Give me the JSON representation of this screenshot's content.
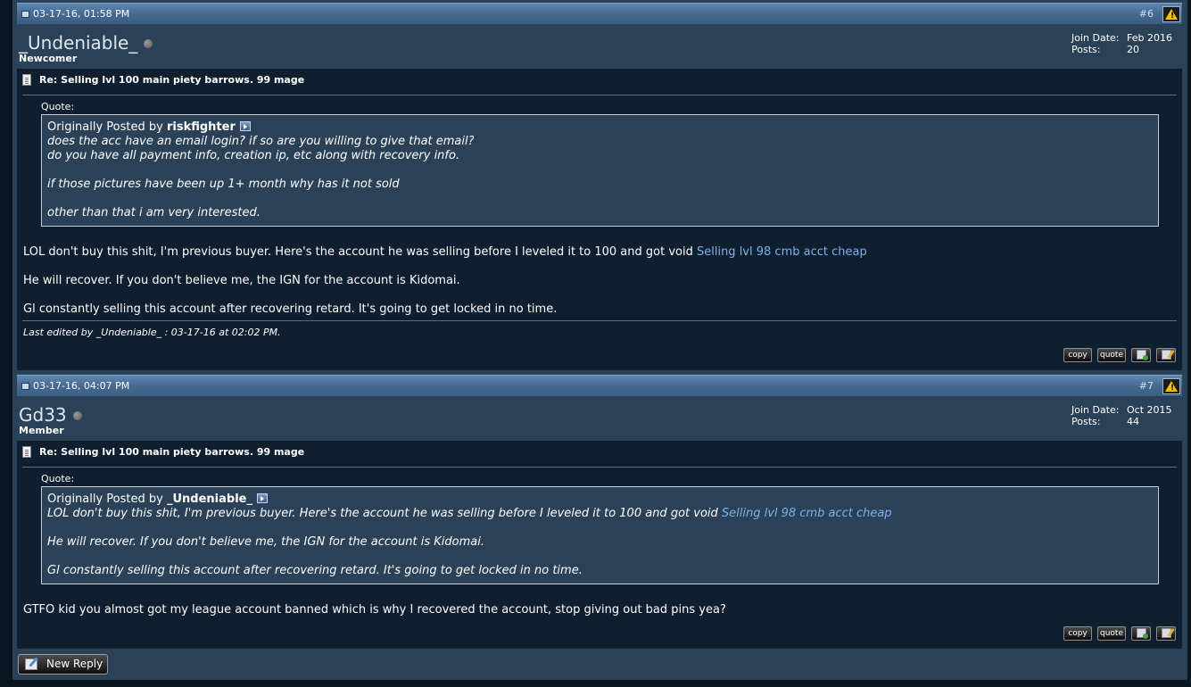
{
  "posts": [
    {
      "date": "03-17-16, 01:58 PM",
      "number": "#6",
      "username": "_Undeniable_",
      "usertitle": "Newcomer",
      "join_date_label": "Join Date:",
      "join_date": "Feb 2016",
      "posts_label": "Posts:",
      "posts_count": "20",
      "title": "Re: Selling lvl 100 main piety barrows. 99 mage",
      "quote_label": "Quote:",
      "quote_prefix": "Originally Posted by",
      "quote_author": "riskfighter",
      "quote_lines": [
        "does the acc have an email login? if so are you willing to give that email?",
        "do you have all payment info, creation ip, etc along with recovery info.",
        "",
        "if those pictures have been up 1+ month why has it not sold",
        "",
        "other than that i am very interested."
      ],
      "message_1": "LOL don't buy this shit, I'm previous buyer. Here's the account he was selling before I leveled it to 100 and got void ",
      "message_1_link": "Selling lvl 98 cmb acct cheap",
      "message_2": "He will recover. If you don't believe me, the IGN for the account is Kidomai.",
      "message_3": "Gl constantly selling this account after recovering retard. It's going to get locked in no time.",
      "edited": "Last edited by _Undeniable_ : 03-17-16 at 02:02 PM."
    },
    {
      "date": "03-17-16, 04:07 PM",
      "number": "#7",
      "username": "Gd33",
      "usertitle": "Member",
      "join_date_label": "Join Date:",
      "join_date": "Oct 2015",
      "posts_label": "Posts:",
      "posts_count": "44",
      "title": "Re: Selling lvl 100 main piety barrows. 99 mage",
      "quote_label": "Quote:",
      "quote_prefix": "Originally Posted by",
      "quote_author": "_Undeniable_",
      "quote_line_1": "LOL don't buy this shit, I'm previous buyer. Here's the account he was selling before I leveled it to 100 and got void ",
      "quote_line_1_link": "Selling lvl 98 cmb acct cheap",
      "quote_line_2": "He will recover. If you don't believe me, the IGN for the account is Kidomai.",
      "quote_line_3": "Gl constantly selling this account after recovering retard. It's going to get locked in no time.",
      "message_1": "GTFO kid you almost got my league account banned which is why I recovered the account, stop giving out bad pins yea?"
    }
  ],
  "buttons": {
    "copy": "copy",
    "quote": "quote"
  },
  "new_reply": "New Reply",
  "icons": {
    "date": "post-date-icon",
    "report": "report-warning-icon",
    "title": "post-document-icon",
    "view_post": "view-post-arrow-icon",
    "multiquote": "multiquote-add-icon",
    "edit": "edit-post-icon",
    "new_reply": "new-reply-icon"
  },
  "colors": {
    "header": "#4d749c",
    "user_area": "#2a4158",
    "post_body": "#0f1f2f",
    "link": "#7fb0ea",
    "warning": "#f2c200"
  }
}
